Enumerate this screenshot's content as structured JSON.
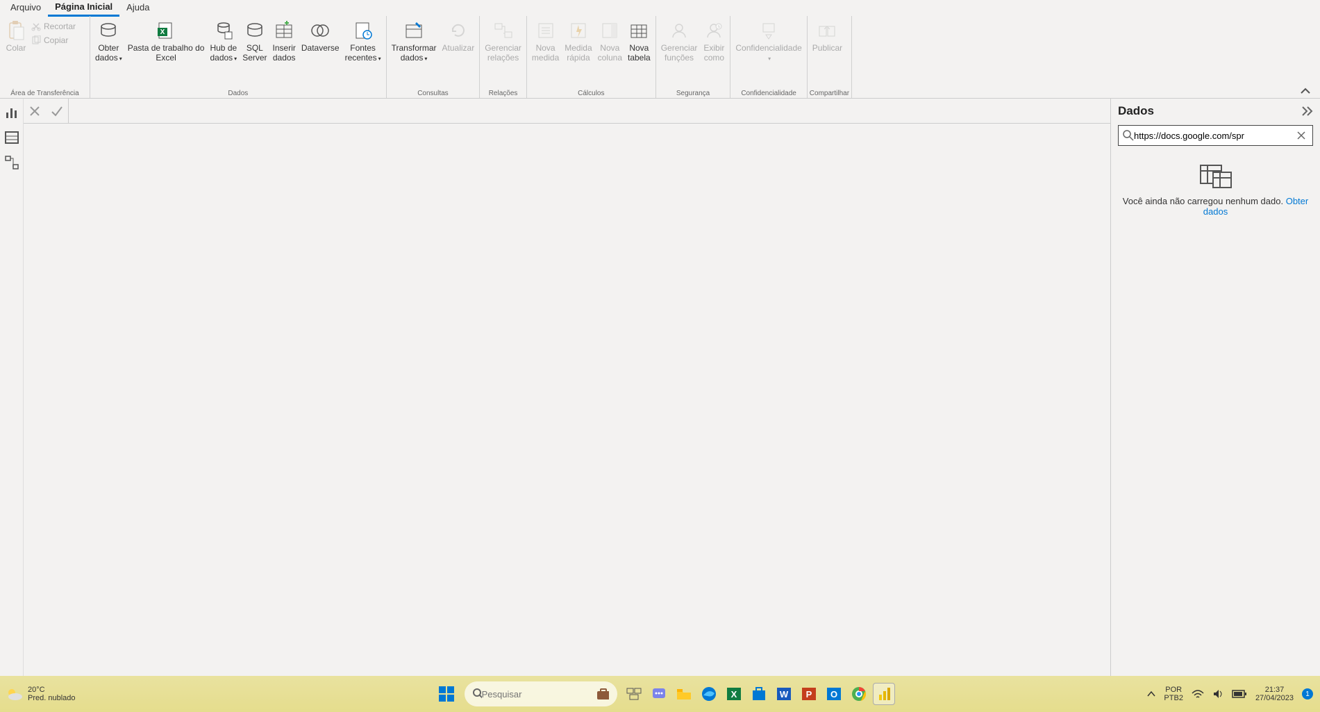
{
  "tabs": {
    "arquivo": "Arquivo",
    "pagina_inicial": "Página Inicial",
    "ajuda": "Ajuda"
  },
  "ribbon": {
    "clipboard_label": "Área de Transferência",
    "colar": "Colar",
    "recortar": "Recortar",
    "copiar": "Copiar",
    "dados_label": "Dados",
    "obter_dados": "Obter\ndados",
    "pasta_excel": "Pasta de trabalho do\nExcel",
    "hub_dados": "Hub de\ndados",
    "sql_server": "SQL\nServer",
    "inserir_dados": "Inserir\ndados",
    "dataverse": "Dataverse",
    "fontes_recentes": "Fontes\nrecentes",
    "consultas_label": "Consultas",
    "transformar_dados": "Transformar\ndados",
    "atualizar": "Atualizar",
    "relacoes_label": "Relações",
    "gerenciar_relacoes": "Gerenciar\nrelações",
    "calculos_label": "Cálculos",
    "nova_medida": "Nova\nmedida",
    "medida_rapida": "Medida\nrápida",
    "nova_coluna": "Nova\ncoluna",
    "nova_tabela": "Nova\ntabela",
    "seguranca_label": "Segurança",
    "gerenciar_funcoes": "Gerenciar\nfunções",
    "exibir_como": "Exibir\ncomo",
    "confidencialidade_label": "Confidencialidade",
    "confidencialidade": "Confidencialidade",
    "compartilhar_label": "Compartilhar",
    "publicar": "Publicar"
  },
  "panel": {
    "title": "Dados",
    "search_value": "https://docs.google.com/spr",
    "empty_text": "Você ainda não carregou nenhum dado.",
    "empty_link": "Obter dados"
  },
  "taskbar": {
    "weather_temp": "20°C",
    "weather_desc": "Pred. nublado",
    "search_placeholder": "Pesquisar",
    "lang": "POR",
    "kbd": "PTB2",
    "time": "21:37",
    "date": "27/04/2023",
    "notif_count": "1"
  }
}
